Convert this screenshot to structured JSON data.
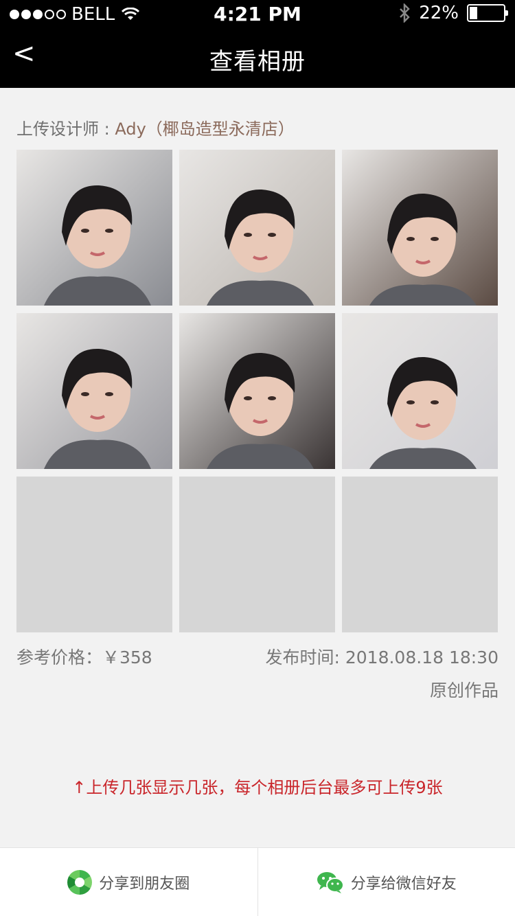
{
  "status_bar": {
    "carrier": "BELL",
    "time": "4:21 PM",
    "battery": "22%",
    "battery_level": 0.22
  },
  "nav": {
    "back_label": "<",
    "title": "查看相册"
  },
  "designer": {
    "prefix": "上传设计师 : ",
    "name": "Ady（椰岛造型永清店）"
  },
  "photos": [
    {
      "id": "photo-1",
      "tone": "#8a8c92"
    },
    {
      "id": "photo-2",
      "tone": "#b9b3ad"
    },
    {
      "id": "photo-3",
      "tone": "#5b4b43"
    },
    {
      "id": "photo-4",
      "tone": "#9a9aa0"
    },
    {
      "id": "photo-5",
      "tone": "#3a3434"
    },
    {
      "id": "photo-6",
      "tone": "#cfcfd4"
    },
    {
      "id": "placeholder-7",
      "tone": "#d6d6d6"
    },
    {
      "id": "placeholder-8",
      "tone": "#d6d6d6"
    },
    {
      "id": "placeholder-9",
      "tone": "#d6d6d6"
    }
  ],
  "details": {
    "price": "参考价格：￥358",
    "publish": "发布时间: 2018.08.18  18:30",
    "original": "原创作品"
  },
  "note": "↑上传几张显示几张，每个相册后台最多可上传9张",
  "share": {
    "moments_label": "分享到朋友圈",
    "friends_label": "分享给微信好友"
  },
  "colors": {
    "accent_red": "#c9252a",
    "designer_name": "#8b6a5b",
    "wechat_green": "#3fb64e"
  }
}
